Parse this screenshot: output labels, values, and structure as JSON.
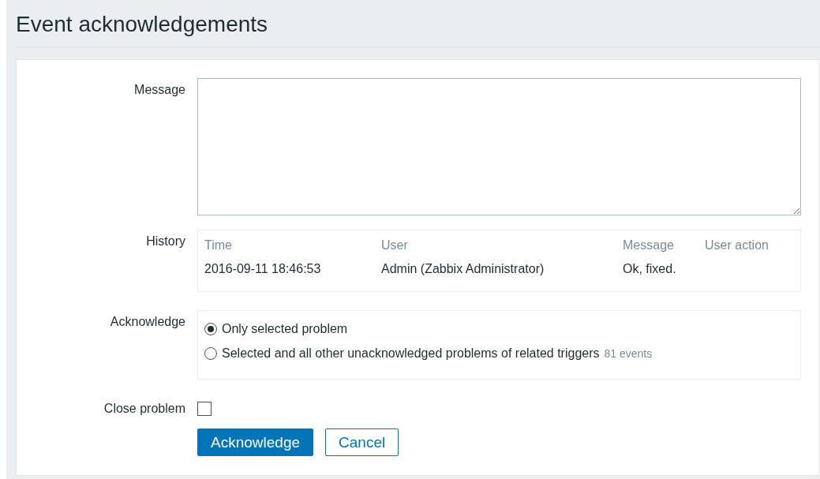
{
  "title": "Event acknowledgements",
  "form": {
    "message": {
      "label": "Message"
    },
    "history": {
      "label": "History",
      "columns": [
        "Time",
        "User",
        "Message",
        "User action"
      ],
      "rows": [
        {
          "time": "2016-09-11 18:46:53",
          "user": "Admin (Zabbix Administrator)",
          "message": "Ok, fixed."
        }
      ]
    },
    "acknowledge": {
      "label": "Acknowledge",
      "options": [
        {
          "label": "Only selected problem",
          "selected": true
        },
        {
          "label": "Selected and all other unacknowledged problems of related triggers",
          "note": "81 events",
          "selected": false
        }
      ]
    },
    "close_problem": {
      "label": "Close problem",
      "checked": false
    },
    "buttons": [
      {
        "label": "Acknowledge",
        "kind": "primary"
      },
      {
        "label": "Cancel",
        "kind": "secondary"
      }
    ]
  }
}
